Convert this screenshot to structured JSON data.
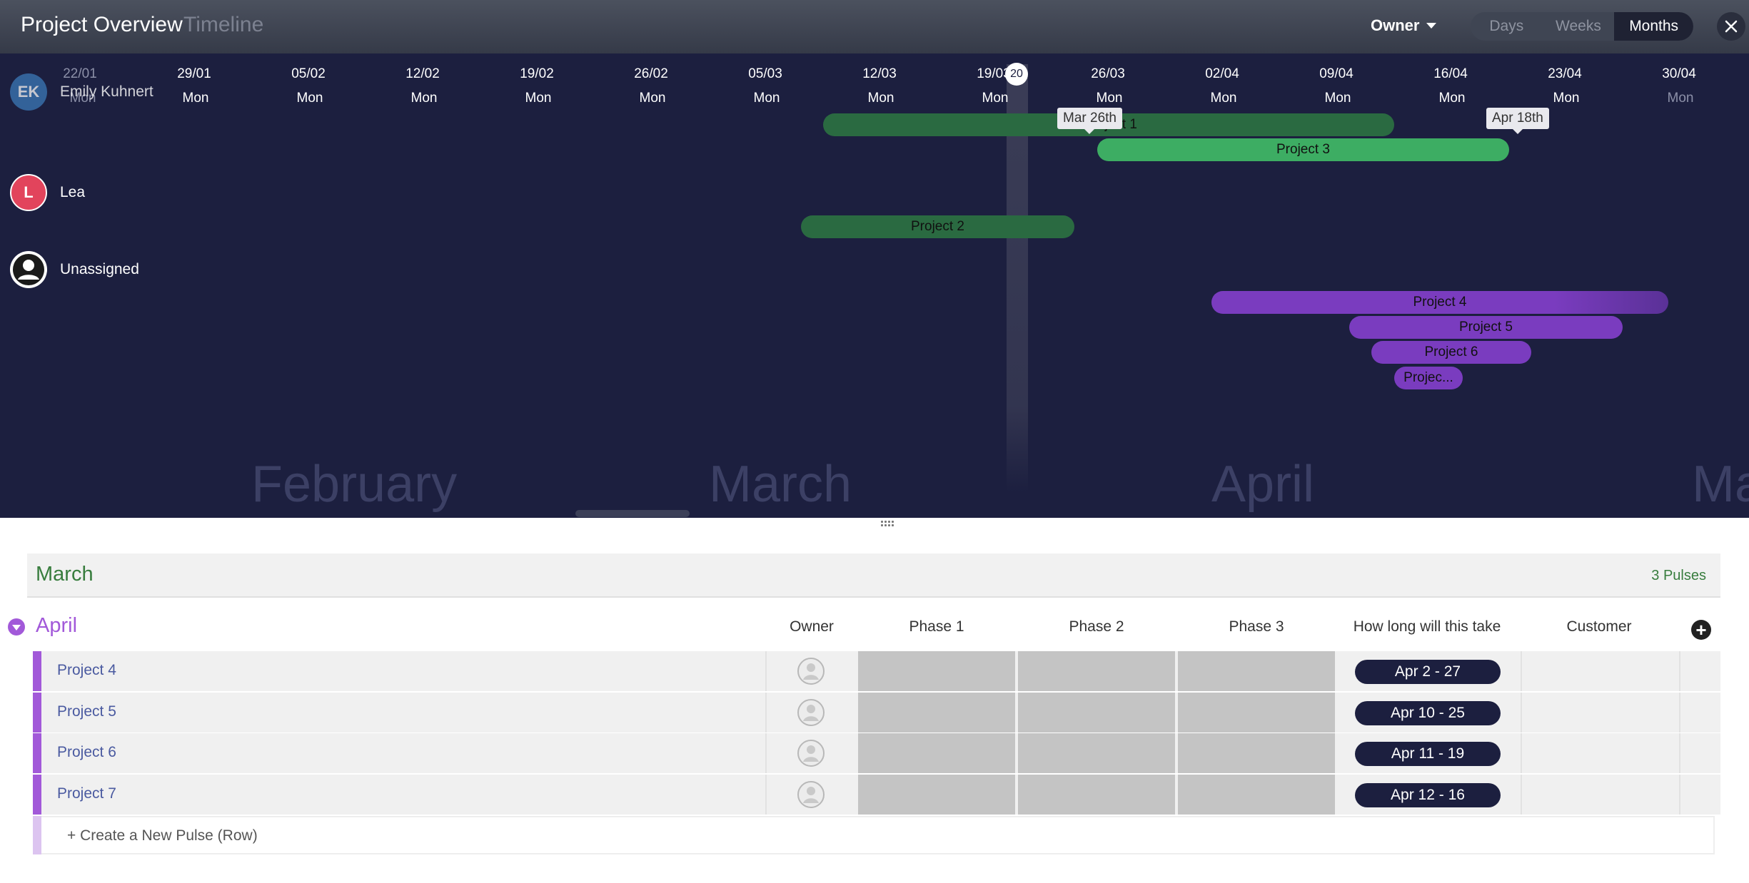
{
  "header": {
    "title": "Project Overview",
    "subtitle": "Timeline",
    "owner_filter": "Owner",
    "views": [
      "Days",
      "Weeks",
      "Months"
    ],
    "active_view": "Months"
  },
  "ruler": [
    {
      "date": "22/01",
      "day": "Mon"
    },
    {
      "date": "29/01",
      "day": "Mon"
    },
    {
      "date": "05/02",
      "day": "Mon"
    },
    {
      "date": "12/02",
      "day": "Mon"
    },
    {
      "date": "19/02",
      "day": "Mon"
    },
    {
      "date": "26/02",
      "day": "Mon"
    },
    {
      "date": "05/03",
      "day": "Mon"
    },
    {
      "date": "12/03",
      "day": "Mon"
    },
    {
      "date": "19/03",
      "day": "Mon"
    },
    {
      "date": "26/03",
      "day": "Mon"
    },
    {
      "date": "02/04",
      "day": "Mon"
    },
    {
      "date": "09/04",
      "day": "Mon"
    },
    {
      "date": "16/04",
      "day": "Mon"
    },
    {
      "date": "23/04",
      "day": "Mon"
    },
    {
      "date": "30/04",
      "day": "Mon"
    }
  ],
  "today_marker": "20",
  "people": [
    {
      "initials": "EK",
      "name": "Emily Kuhnert",
      "color": "#3b79b8"
    },
    {
      "initials": "L",
      "name": "Lea",
      "color": "#e2445c"
    },
    {
      "initials": "",
      "name": "Unassigned",
      "color": "#ffffff"
    }
  ],
  "bars": {
    "project1": "Project 1",
    "project3": "Project 3",
    "project2": "Project 2",
    "project4": "Project 4",
    "project5": "Project 5",
    "project6": "Project 6",
    "project7": "Projec..."
  },
  "date_tips": {
    "start": "Mar 26th",
    "end": "Apr 18th"
  },
  "months": [
    "February",
    "March",
    "April",
    "Ma"
  ],
  "board": {
    "march_group": {
      "name": "March",
      "count": "3 Pulses"
    },
    "april_group": {
      "name": "April",
      "columns": [
        "Owner",
        "Phase 1",
        "Phase 2",
        "Phase 3",
        "How long will this take",
        "Customer"
      ],
      "rows": [
        {
          "name": "Project 4",
          "timeline": "Apr 2 - 27"
        },
        {
          "name": "Project 5",
          "timeline": "Apr 10 - 25"
        },
        {
          "name": "Project 6",
          "timeline": "Apr 11 - 19"
        },
        {
          "name": "Project 7",
          "timeline": "Apr 12 - 16"
        }
      ]
    },
    "create_row": "+ Create a New Pulse (Row)"
  },
  "colors": {
    "timeline_bg": "#1c1f3f",
    "green_group": "#387d3e",
    "purple_group": "#a259d9",
    "bar_purple": "#7a3cbf",
    "bar_green": "#3dad63"
  }
}
